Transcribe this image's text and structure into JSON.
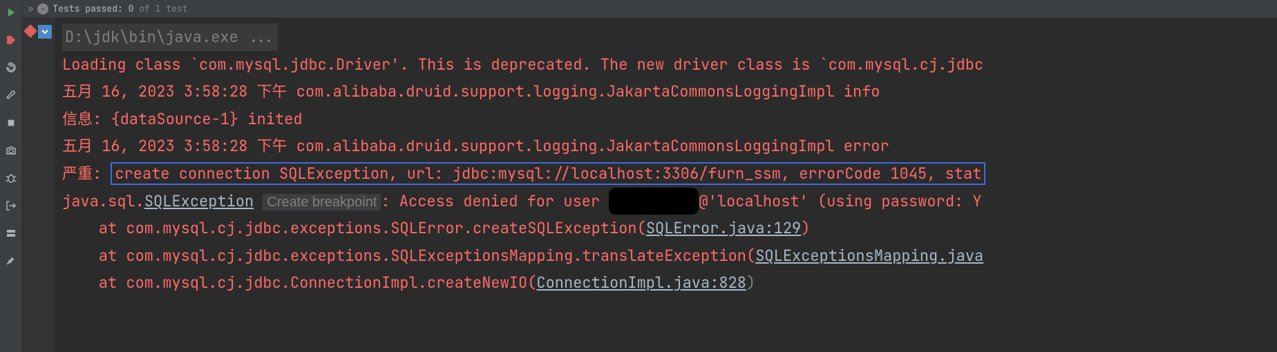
{
  "topbar": {
    "breadcrumb_prefix": "»",
    "test_status_label": "Tests passed:",
    "test_passed": "0",
    "test_total": "of 1 test"
  },
  "console": {
    "cmd": "D:\\jdk\\bin\\java.exe ...",
    "line1": "Loading class `com.mysql.jdbc.Driver'. This is deprecated. The new driver class is `com.mysql.cj.jdbc",
    "line2": "五月 16, 2023 3:58:28 下午 com.alibaba.druid.support.logging.JakartaCommonsLoggingImpl info",
    "line3": "信息: {dataSource-1} inited",
    "line4": "五月 16, 2023 3:58:28 下午 com.alibaba.druid.support.logging.JakartaCommonsLoggingImpl error",
    "line5_prefix": "严重: ",
    "line5_highlight": "create connection SQLException, url: jdbc:mysql://localhost:3306/furn_ssm, errorCode 1045, stat",
    "line6_pkg": "java.sql.",
    "line6_class": "SQLException",
    "line6_hint": "Create breakpoint",
    "line6_msg_pre": ": Access denied for user ",
    "line6_msg_post": "@'localhost' (using password: Y",
    "stack1_pre": "    at com.mysql.cj.jdbc.exceptions.SQLError.createSQLException(",
    "stack1_link": "SQLError.java:129",
    "stack1_post": ")",
    "stack2_pre": "    at com.mysql.cj.jdbc.exceptions.SQLExceptionsMapping.translateException(",
    "stack2_link": "SQLExceptionsMapping.java",
    "stack3_pre": "    at com.mysql.cj.jdbc.ConnectionImpl.createNewIO(",
    "stack3_link": "ConnectionImpl.java:828",
    "stack3_post": ")"
  },
  "icons": {
    "play": "play-icon",
    "breakpoint": "breakpoint-icon",
    "refresh": "refresh-icon",
    "wrench": "wrench-icon",
    "stop": "stop-icon",
    "camera": "camera-icon",
    "bug": "bug-icon",
    "exit": "exit-icon",
    "layout": "layout-icon",
    "pin": "pin-icon"
  }
}
